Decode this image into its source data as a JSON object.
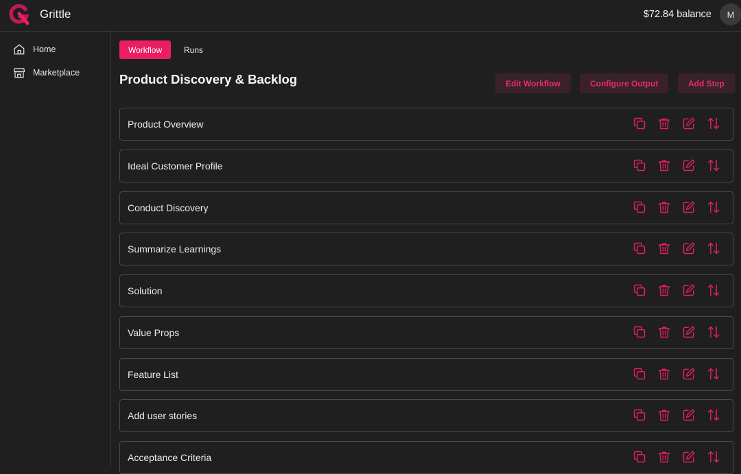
{
  "header": {
    "app_name": "Grittle",
    "balance": "$72.84 balance",
    "avatar_initial": "M"
  },
  "sidebar": {
    "items": [
      {
        "label": "Home",
        "icon": "home-icon"
      },
      {
        "label": "Marketplace",
        "icon": "store-icon"
      }
    ]
  },
  "tabs": [
    {
      "label": "Workflow",
      "active": true
    },
    {
      "label": "Runs",
      "active": false
    }
  ],
  "page": {
    "title": "Product Discovery & Backlog",
    "actions": {
      "edit_workflow": "Edit Workflow",
      "configure_output": "Configure Output",
      "add_step": "Add Step"
    }
  },
  "steps": [
    {
      "label": "Product Overview"
    },
    {
      "label": "Ideal Customer Profile"
    },
    {
      "label": "Conduct Discovery"
    },
    {
      "label": "Summarize Learnings"
    },
    {
      "label": "Solution"
    },
    {
      "label": "Value Props"
    },
    {
      "label": "Feature List"
    },
    {
      "label": "Add user stories"
    },
    {
      "label": "Acceptance Criteria"
    }
  ],
  "step_action_icons": [
    "copy-icon",
    "trash-icon",
    "edit-icon",
    "reorder-icon"
  ],
  "colors": {
    "accent": "#e91e63",
    "background": "#1f1f20",
    "button_bg": "#3a2027",
    "border": "#4a4a4c"
  }
}
